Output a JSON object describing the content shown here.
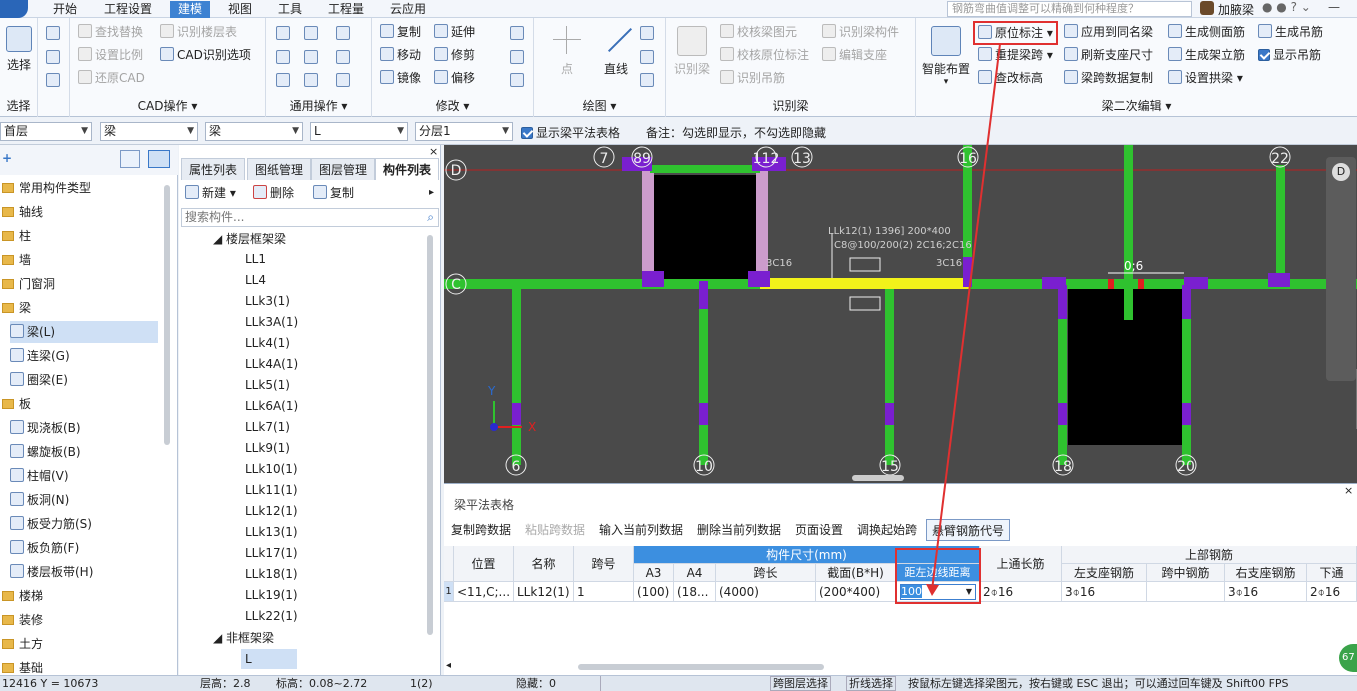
{
  "menu": {
    "items": [
      "开始",
      "工程设置",
      "建模",
      "视图",
      "工具",
      "工程量",
      "云应用"
    ],
    "active": 2,
    "search_placeholder": "钢筋弯曲值调整可以精确到何种程度？",
    "user": "加腋梁"
  },
  "ribbon": {
    "select_label": "选择",
    "select_group": "选择",
    "cad": {
      "btns": [
        "查找替换",
        "设置比例",
        "还原CAD",
        "识别楼层表",
        "CAD识别选项"
      ],
      "group": "CAD操作"
    },
    "common": {
      "group": "通用操作"
    },
    "modify": {
      "btns": [
        "复制",
        "移动",
        "镜像",
        "延伸",
        "修剪",
        "偏移"
      ],
      "group": "修改"
    },
    "draw": {
      "btns": [
        "点",
        "直线"
      ],
      "group": "绘图"
    },
    "recog": {
      "btns": [
        "识别梁",
        "校核梁图元",
        "校核原位标注",
        "识别吊筋",
        "识别梁构件",
        "编辑支座"
      ],
      "group": "识别梁"
    },
    "edit": {
      "big": "智能布置",
      "btns": [
        "原位标注",
        "重提梁跨",
        "查改标高",
        "应用到同名梁",
        "刷新支座尺寸",
        "梁跨数据复制",
        "生成侧面筋",
        "生成架立筋",
        "设置拱梁",
        "生成吊筋",
        "显示吊筋"
      ],
      "group": "梁二次编辑"
    }
  },
  "toolbar2": {
    "floor": "首层",
    "cat1": "梁",
    "cat2": "梁",
    "type": "L",
    "layer": "分层1",
    "show_table": "显示梁平法表格",
    "note": "备注：勾选即显示，不勾选即隐藏"
  },
  "tree": {
    "items": [
      "常用构件类型",
      "轴线",
      "柱",
      "墙",
      "门窗洞",
      "梁",
      "梁(L)",
      "连梁(G)",
      "圈梁(E)",
      "板",
      "现浇板(B)",
      "螺旋板(B)",
      "柱帽(V)",
      "板洞(N)",
      "板受力筋(S)",
      "板负筋(F)",
      "楼层板带(H)",
      "楼梯",
      "装修",
      "土方",
      "基础"
    ]
  },
  "mid": {
    "tabs": [
      "属性列表",
      "图纸管理",
      "图层管理",
      "构件列表"
    ],
    "new": "新建",
    "delete": "删除",
    "copy": "复制",
    "search": "搜索构件...",
    "group1": "楼层框架梁",
    "beams": [
      "LL1",
      "LL4",
      "LLk3(1)",
      "LLk3A(1)",
      "LLk4(1)",
      "LLk4A(1)",
      "LLk5(1)",
      "LLk6A(1)",
      "LLk7(1)",
      "LLk9(1)",
      "LLk10(1)",
      "LLk11(1)",
      "LLk12(1)",
      "LLk13(1)",
      "LLk17(1)",
      "LLk18(1)",
      "LLk19(1)",
      "LLk22(1)"
    ],
    "group2": "非框架梁",
    "beam2": "L"
  },
  "canvas": {
    "axes_top": [
      "7",
      "89",
      "112",
      "13",
      "16",
      "22"
    ],
    "axes_bottom": [
      "6",
      "10",
      "15",
      "18",
      "20"
    ],
    "axes_left": [
      "D",
      "C"
    ],
    "ann1": "LLk12(1) 1396] 200*400",
    "ann2": "C8@100/200(2) 2C16;2C16",
    "lbl3c16a": "3C16",
    "lbl3c16b": "3C16",
    "lbl06": "0;6",
    "nav": "D",
    "x": "X",
    "y": "Y"
  },
  "table": {
    "title": "梁平法表格",
    "btns": [
      "复制跨数据",
      "粘贴跨数据",
      "输入当前列数据",
      "删除当前列数据",
      "页面设置",
      "调换起始跨",
      "悬臂钢筋代号"
    ],
    "h_pos": "位置",
    "h_name": "名称",
    "h_span": "跨号",
    "h_size": "构件尺寸(mm)",
    "h_a3": "A3",
    "h_a4": "A4",
    "h_len": "跨长",
    "h_sec": "截面(B*H)",
    "h_dist": "距左边线距离",
    "h_uplong": "上通长筋",
    "h_top": "上部钢筋",
    "h_left": "左支座钢筋",
    "h_mid": "跨中钢筋",
    "h_right": "右支座钢筋",
    "h_down": "下通",
    "row": {
      "idx": "1",
      "pos": "<11,C;...",
      "name": "LLk12(1)",
      "span": "1",
      "a3": "(100)",
      "a4": "(18...",
      "len": "(4000)",
      "sec": "(200*400)",
      "dist": "100",
      "uplong": "2⌽16",
      "left": "3⌽16",
      "mid": "",
      "right": "3⌽16",
      "down": "2⌽16"
    }
  },
  "status": {
    "coord": "12416 Y = 10673",
    "floor": "层高：2.8",
    "elev": "标高：0.08~2.72",
    "count": "1(2)",
    "hidden": "隐藏：0",
    "b1": "跨图层选择",
    "b2": "折线选择",
    "hint": "按鼠标左键选择梁图元，按右键或 ESC 退出；可以通过回车键及 Shift00 FPS",
    "fps": "67"
  }
}
